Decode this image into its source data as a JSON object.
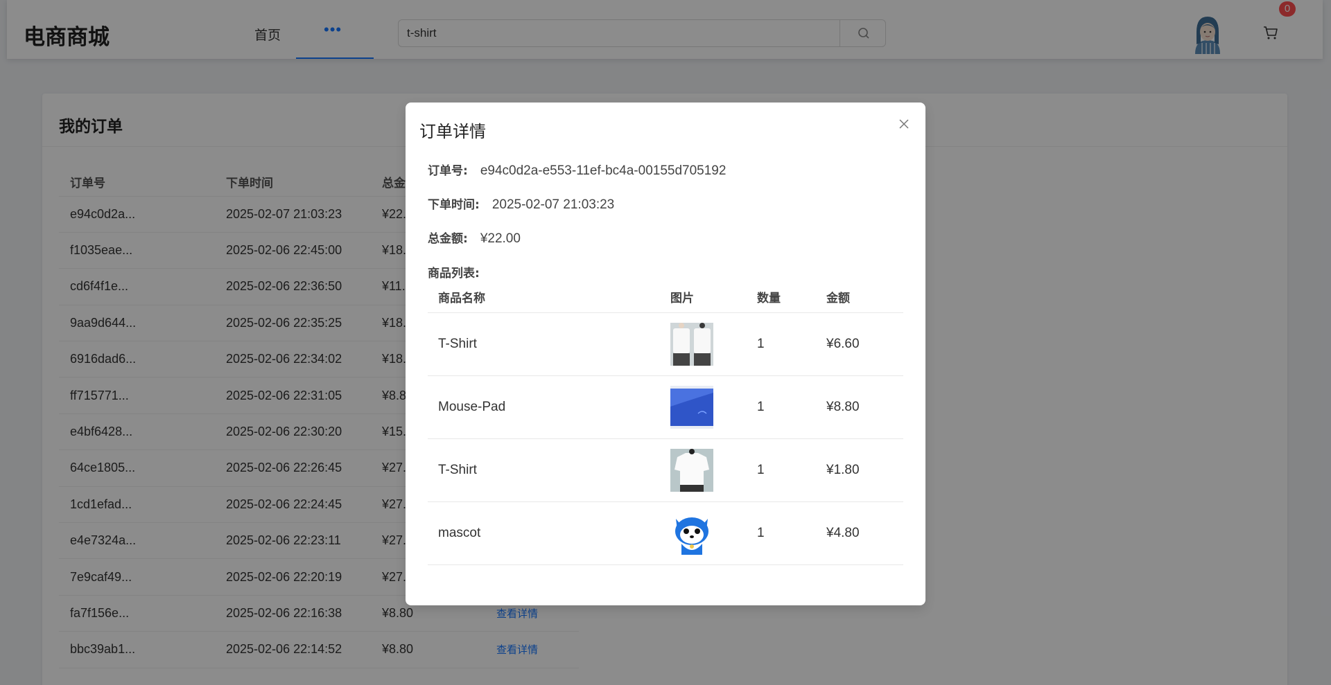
{
  "header": {
    "logo": "电商商城",
    "nav_home": "首页",
    "nav_more": "•••",
    "search_value": "t-shirt",
    "cart_count": "0"
  },
  "orders_card": {
    "title": "我的订单",
    "columns": [
      "订单号",
      "下单时间",
      "总金额",
      ""
    ],
    "rows": [
      {
        "id": "e94c0d2a...",
        "time": "2025-02-07 21:03:23",
        "total": "¥22.",
        "action": ""
      },
      {
        "id": "f1035eae...",
        "time": "2025-02-06 22:45:00",
        "total": "¥18.",
        "action": ""
      },
      {
        "id": "cd6f4f1e...",
        "time": "2025-02-06 22:36:50",
        "total": "¥11.",
        "action": ""
      },
      {
        "id": "9aa9d644...",
        "time": "2025-02-06 22:35:25",
        "total": "¥18.",
        "action": ""
      },
      {
        "id": "6916dad6...",
        "time": "2025-02-06 22:34:02",
        "total": "¥18.",
        "action": ""
      },
      {
        "id": "ff715771...",
        "time": "2025-02-06 22:31:05",
        "total": "¥8.8",
        "action": ""
      },
      {
        "id": "e4bf6428...",
        "time": "2025-02-06 22:30:20",
        "total": "¥15.",
        "action": ""
      },
      {
        "id": "64ce1805...",
        "time": "2025-02-06 22:26:45",
        "total": "¥27.",
        "action": ""
      },
      {
        "id": "1cd1efad...",
        "time": "2025-02-06 22:24:45",
        "total": "¥27.",
        "action": ""
      },
      {
        "id": "e4e7324a...",
        "time": "2025-02-06 22:23:11",
        "total": "¥27.",
        "action": ""
      },
      {
        "id": "7e9caf49...",
        "time": "2025-02-06 22:20:19",
        "total": "¥27.",
        "action": ""
      },
      {
        "id": "fa7f156e...",
        "time": "2025-02-06 22:16:38",
        "total": "¥8.80",
        "action": "查看详情"
      },
      {
        "id": "bbc39ab1...",
        "time": "2025-02-06 22:14:52",
        "total": "¥8.80",
        "action": "查看详情"
      }
    ]
  },
  "modal": {
    "title": "订单详情",
    "order_id_label": "订单号:",
    "order_id": "e94c0d2a-e553-11ef-bc4a-00155d705192",
    "time_label": "下单时间:",
    "time": "2025-02-07 21:03:23",
    "total_label": "总金额:",
    "total": "¥22.00",
    "items_label": "商品列表:",
    "columns": [
      "商品名称",
      "图片",
      "数量",
      "金额"
    ],
    "items": [
      {
        "name": "T-Shirt",
        "image": "tshirt-photo",
        "qty": "1",
        "price": "¥6.60"
      },
      {
        "name": "Mouse-Pad",
        "image": "mousepad-photo",
        "qty": "1",
        "price": "¥8.80"
      },
      {
        "name": "T-Shirt",
        "image": "tshirt-back-photo",
        "qty": "1",
        "price": "¥1.80"
      },
      {
        "name": "mascot",
        "image": "mascot-photo",
        "qty": "1",
        "price": "¥4.80"
      }
    ]
  },
  "colors": {
    "accent": "#1677ff",
    "badge": "#ff4d4f",
    "mask": "rgba(0,0,0,0.45)"
  }
}
